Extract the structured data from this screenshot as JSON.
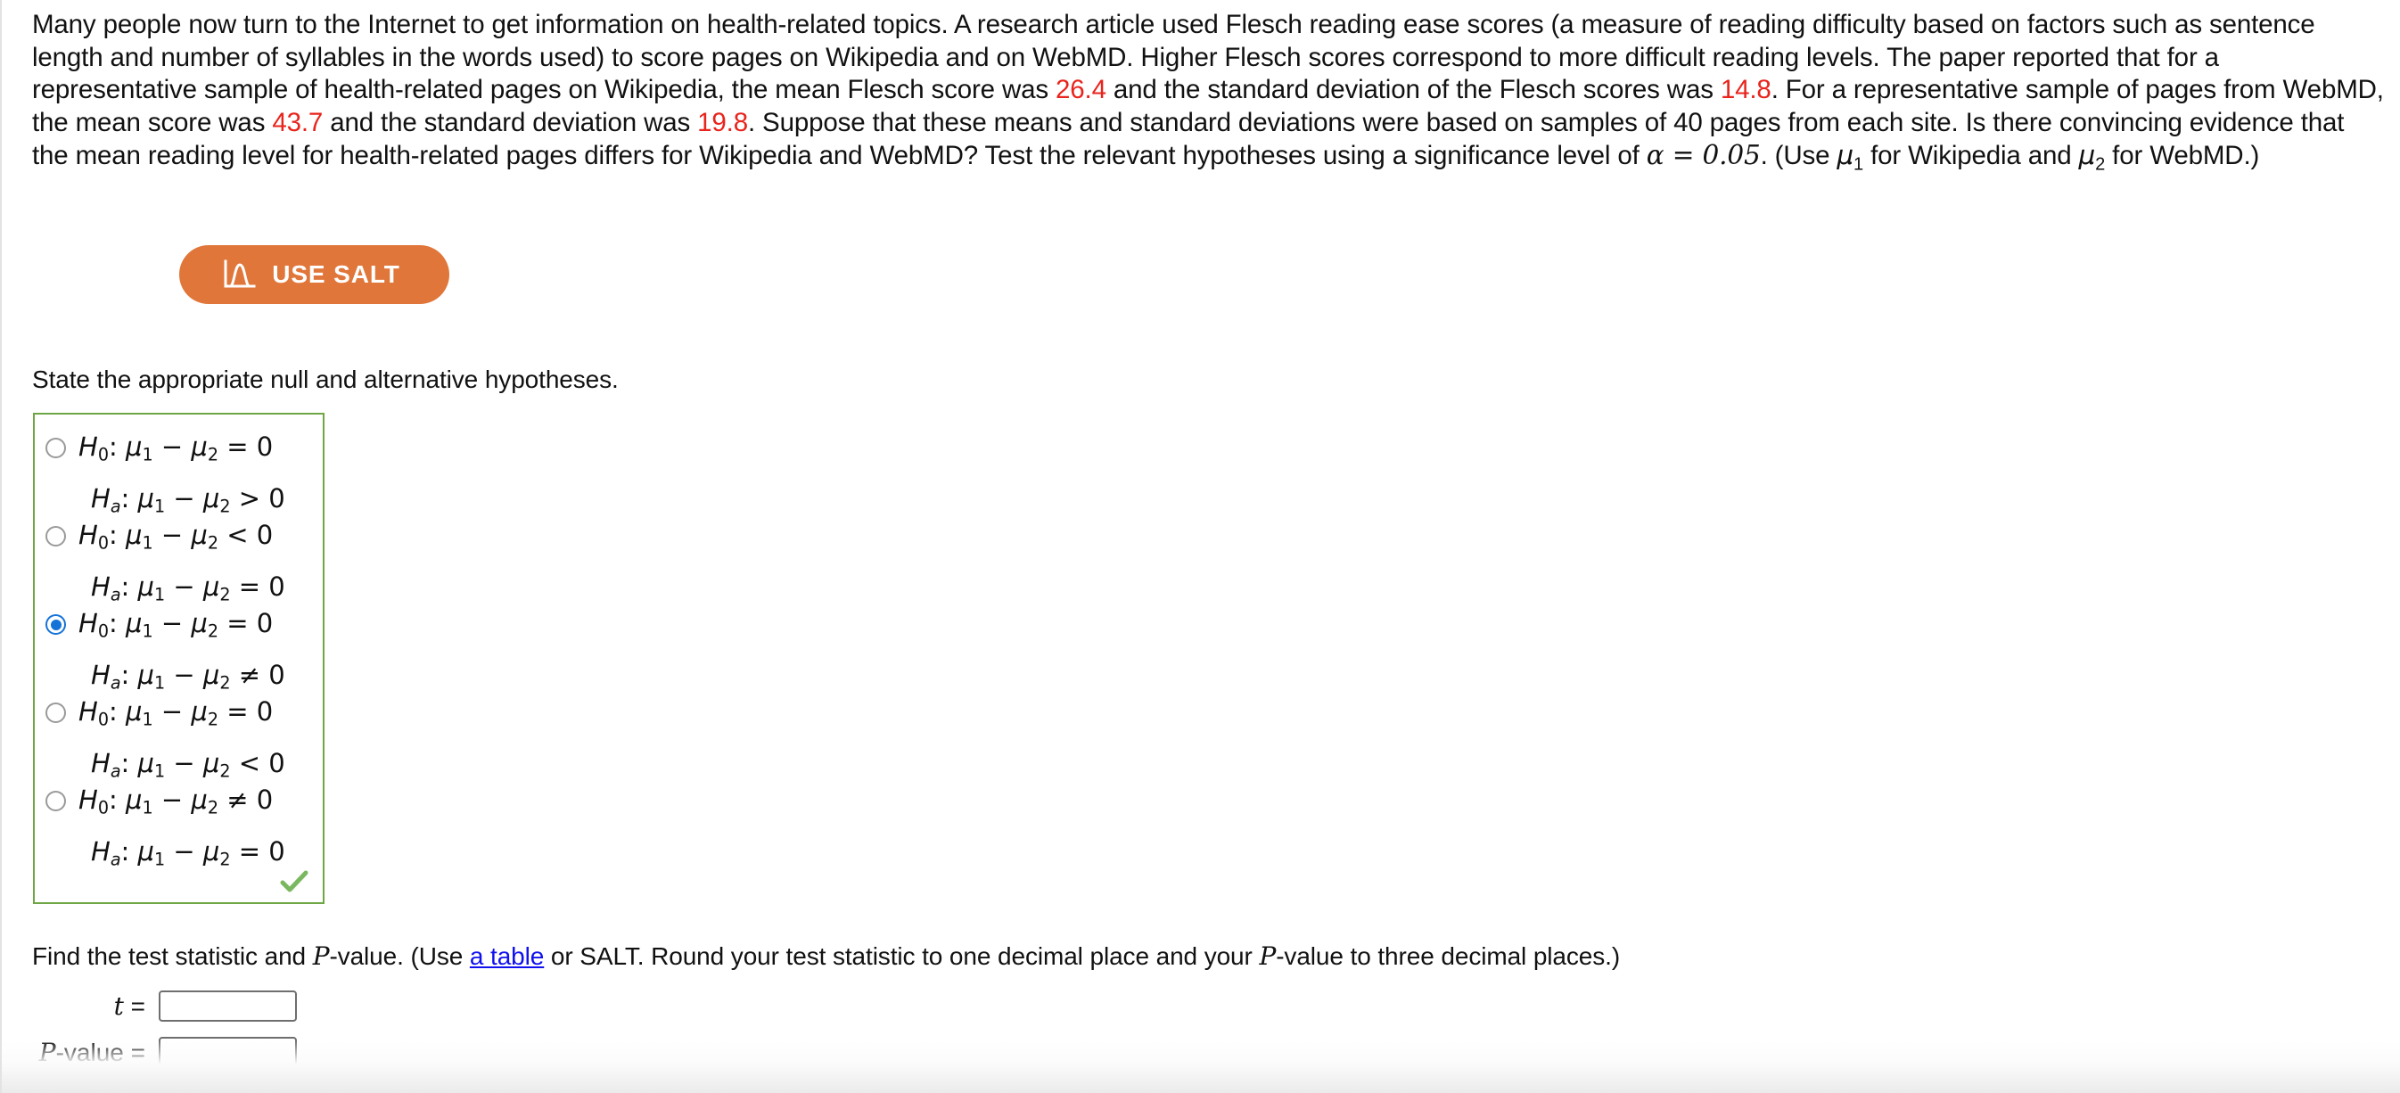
{
  "problem": {
    "segments": [
      {
        "t": "Many people now turn to the Internet to get information on health-related topics. A research article used Flesch reading ease scores (a measure of reading difficulty based on factors such as sentence length and number of syllables in the words used) to score pages on Wikipedia and on WebMD. Higher Flesch scores correspond to more difficult reading levels. The paper reported that for a representative sample of health-related pages on Wikipedia, the mean Flesch score was ",
        "style": "plain"
      },
      {
        "t": "26.4",
        "style": "red"
      },
      {
        "t": " and the standard deviation of the Flesch scores was ",
        "style": "plain"
      },
      {
        "t": "14.8",
        "style": "red"
      },
      {
        "t": ". For a representative sample of pages from WebMD, the mean score was ",
        "style": "plain"
      },
      {
        "t": "43.7",
        "style": "red"
      },
      {
        "t": " and the standard deviation was ",
        "style": "plain"
      },
      {
        "t": "19.8",
        "style": "red"
      },
      {
        "t": ". Suppose that these means and standard deviations were based on samples of 40 pages from each site. Is there convincing evidence that the mean reading level for health-related pages differs for Wikipedia and WebMD? Test the relevant hypotheses using a significance level of ",
        "style": "plain"
      },
      {
        "t": "α = 0.05",
        "style": "math-italic"
      },
      {
        "t": ". (Use ",
        "style": "plain"
      },
      {
        "t": "μ₁",
        "style": "mu-sub"
      },
      {
        "t": " for Wikipedia and ",
        "style": "plain"
      },
      {
        "t": "μ₂",
        "style": "mu-sub"
      },
      {
        "t": " for WebMD.)",
        "style": "plain"
      }
    ],
    "mean_wikipedia": "26.4",
    "sd_wikipedia": "14.8",
    "mean_webmd": "43.7",
    "sd_webmd": "19.8",
    "sample_size": "40",
    "alpha": "0.05"
  },
  "salt_button": {
    "label": "USE SALT",
    "icon": "distribution-curve-icon",
    "background_color": "#e0763a",
    "text_color": "#ffffff"
  },
  "hypotheses_section": {
    "prompt": "State the appropriate null and alternative hypotheses.",
    "border_color": "#6fa645",
    "status": "correct",
    "selected_index": 2,
    "options": [
      {
        "null": "H₀: μ₁ − μ₂ = 0",
        "alt": "Hₐ: μ₁ − μ₂ > 0",
        "selected": false
      },
      {
        "null": "H₀: μ₁ − μ₂ < 0",
        "alt": "Hₐ: μ₁ − μ₂ = 0",
        "selected": false
      },
      {
        "null": "H₀: μ₁ − μ₂ = 0",
        "alt": "Hₐ: μ₁ − μ₂ ≠ 0",
        "selected": true
      },
      {
        "null": "H₀: μ₁ − μ₂ = 0",
        "alt": "Hₐ: μ₁ − μ₂ < 0",
        "selected": false
      },
      {
        "null": "H₀: μ₁ − μ₂ ≠ 0",
        "alt": "Hₐ: μ₁ − μ₂ = 0",
        "selected": false
      }
    ]
  },
  "test_statistic_section": {
    "prompt_part1": "Find the test statistic and ",
    "prompt_pvalue1": "P",
    "prompt_part2": "-value. (Use ",
    "link_text": "a table",
    "prompt_part3": " or SALT. Round your test statistic to one decimal place and your ",
    "prompt_pvalue2": "P",
    "prompt_part4": "-value to three decimal places.)",
    "fields": [
      {
        "label_math": "t",
        "label_rest": "",
        "equals": "=",
        "value": "",
        "placeholder": ""
      },
      {
        "label_math": "P",
        "label_rest": "-value",
        "equals": "=",
        "value": "",
        "placeholder": ""
      }
    ]
  }
}
